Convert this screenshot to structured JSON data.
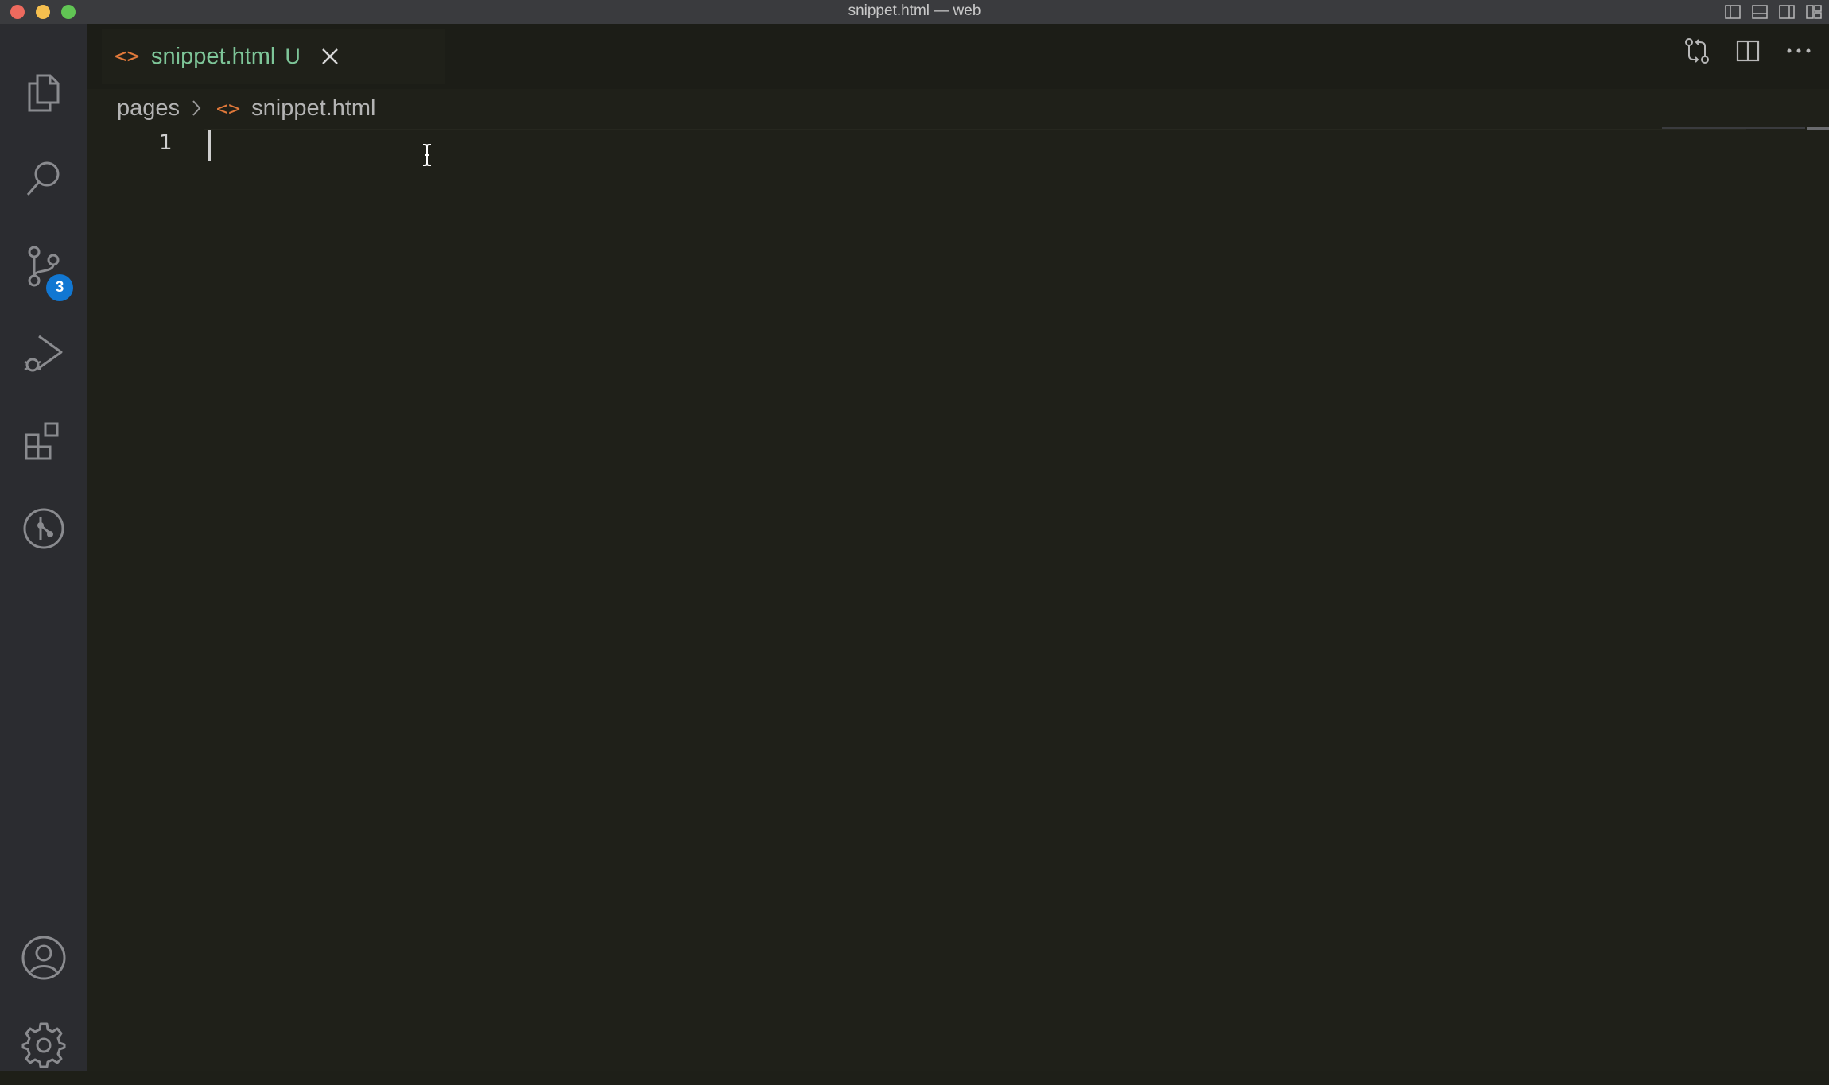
{
  "window": {
    "title": "snippet.html — web"
  },
  "activity_bar": {
    "items": [
      {
        "name": "explorer",
        "icon": "files-icon"
      },
      {
        "name": "search",
        "icon": "search-icon"
      },
      {
        "name": "source-control",
        "icon": "source-control-icon",
        "badge": "3"
      },
      {
        "name": "run-and-debug",
        "icon": "run-debug-icon"
      },
      {
        "name": "extensions",
        "icon": "extensions-icon"
      },
      {
        "name": "git-graph",
        "icon": "git-graph-icon"
      }
    ],
    "bottom_items": [
      {
        "name": "accounts",
        "icon": "account-icon"
      },
      {
        "name": "manage",
        "icon": "gear-icon"
      }
    ]
  },
  "tab": {
    "icon": "<>",
    "label": "snippet.html",
    "status": "U"
  },
  "breadcrumb": {
    "folder": "pages",
    "file_icon": "<>",
    "file": "snippet.html"
  },
  "editor": {
    "line_numbers": [
      "1"
    ]
  },
  "colors": {
    "accent_badge": "#1177d2",
    "html_icon": "#e1793a",
    "untracked_green": "#7ec699",
    "editor_bg": "#1f2019",
    "activity_bg": "#2b2c30"
  }
}
